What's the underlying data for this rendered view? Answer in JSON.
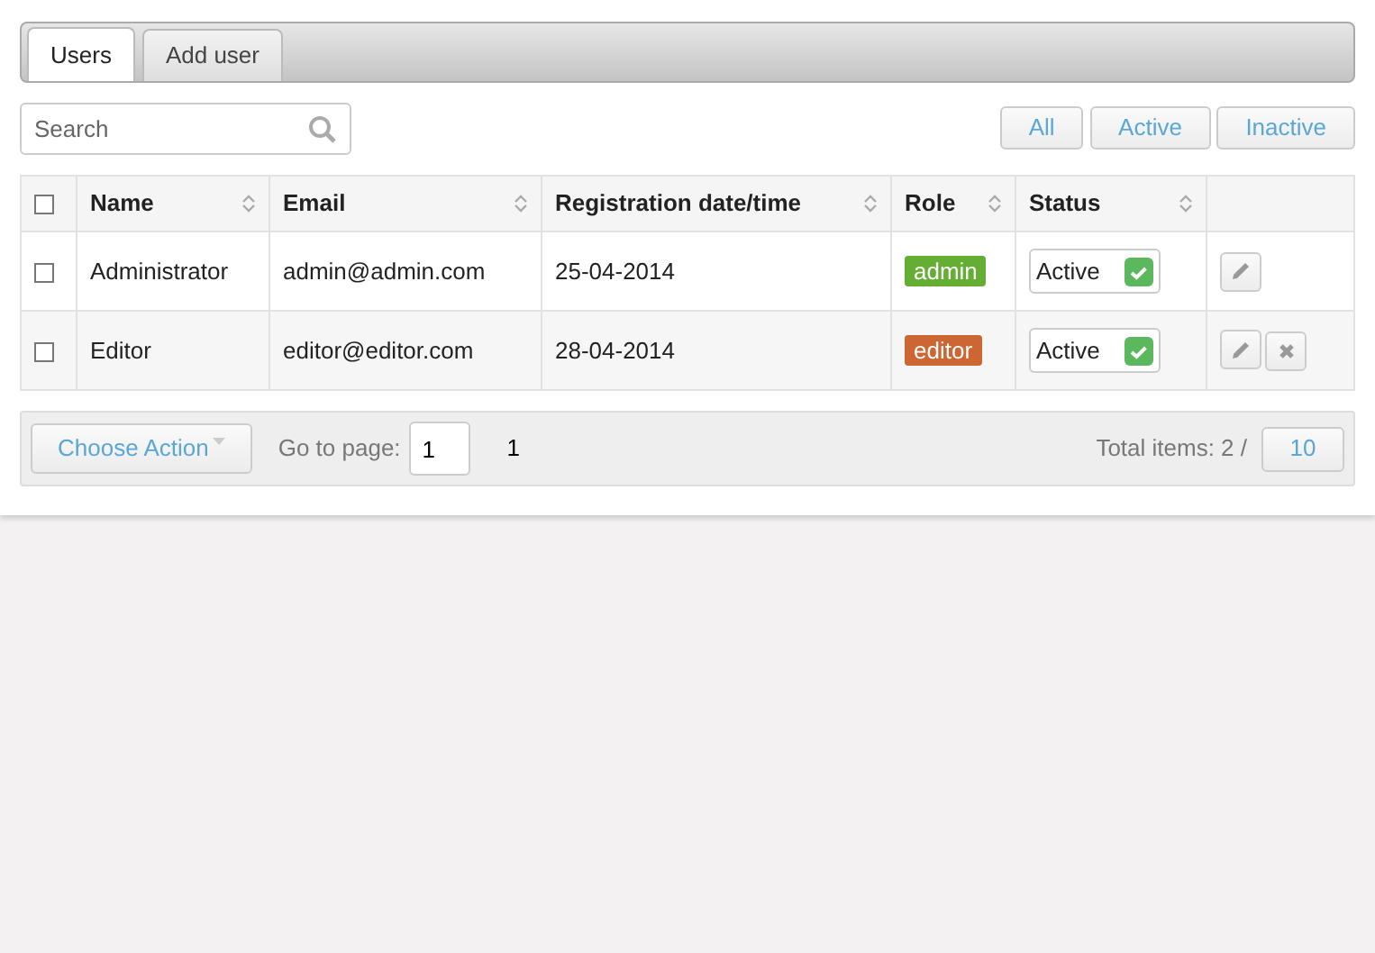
{
  "tabs": [
    {
      "label": "Users",
      "selected": true
    },
    {
      "label": "Add user",
      "selected": false
    }
  ],
  "search": {
    "placeholder": "Search"
  },
  "filters": [
    {
      "label": "All"
    },
    {
      "label": "Active"
    },
    {
      "label": "Inactive"
    }
  ],
  "table": {
    "select_all": {
      "checked": false
    },
    "columns": [
      {
        "label": "Name",
        "sortable": true
      },
      {
        "label": "Email",
        "sortable": true
      },
      {
        "label": "Registration date/time",
        "sortable": true
      },
      {
        "label": "Role",
        "sortable": true
      },
      {
        "label": "Status",
        "sortable": true
      }
    ],
    "rows": [
      {
        "checked": false,
        "name": "Administrator",
        "email": "admin@admin.com",
        "registered": "25-04-2014",
        "role": {
          "label": "admin",
          "color": "#64ae34"
        },
        "status": {
          "label": "Active",
          "on": true
        },
        "actions": [
          {
            "kind": "edit"
          }
        ]
      },
      {
        "checked": false,
        "name": "Editor",
        "email": "editor@editor.com",
        "registered": "28-04-2014",
        "role": {
          "label": "editor",
          "color": "#cc6633"
        },
        "status": {
          "label": "Active",
          "on": true
        },
        "actions": [
          {
            "kind": "edit"
          },
          {
            "kind": "delete"
          }
        ]
      }
    ]
  },
  "footer": {
    "action_button": "Choose Action",
    "goto_label": "Go to page:",
    "goto_value": "1",
    "pages": [
      {
        "label": "1"
      }
    ],
    "total": "Total items: 2 /",
    "per_page": "10"
  }
}
